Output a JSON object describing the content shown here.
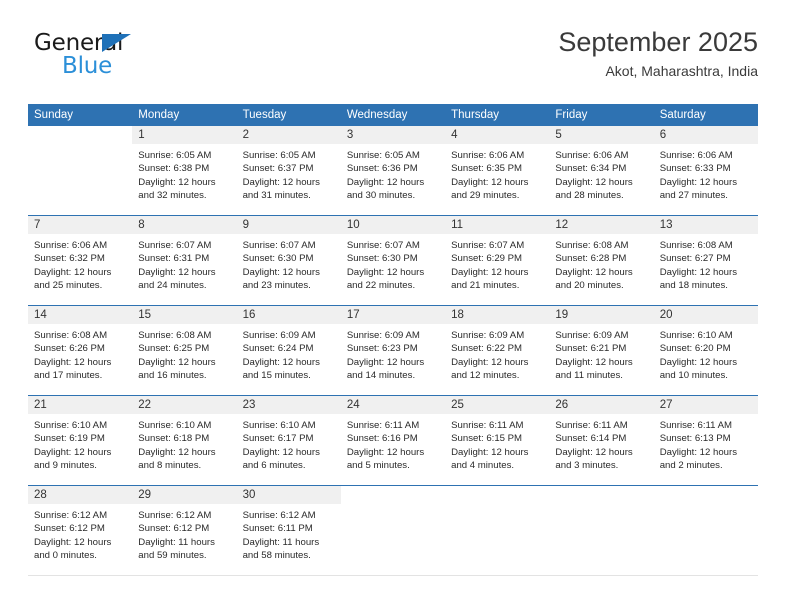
{
  "brand": {
    "name_top": "General",
    "name_bottom": "Blue",
    "triangle_icon": "brand-triangle-icon",
    "accent_color": "#1f71b8",
    "blue_text_color": "#2b8fd8"
  },
  "header": {
    "month_title": "September 2025",
    "location": "Akot, Maharashtra, India"
  },
  "theme": {
    "header_blue": "#2e72b2",
    "daynum_band": "#f0f0f0",
    "row_divider": "#2e72b2",
    "text": "#2a2a2a"
  },
  "calendar": {
    "weekday_headers": [
      "Sunday",
      "Monday",
      "Tuesday",
      "Wednesday",
      "Thursday",
      "Friday",
      "Saturday"
    ],
    "weeks": [
      [
        {
          "day": "",
          "sunrise": "",
          "sunset": "",
          "daylight_line1": "",
          "daylight_line2": "",
          "empty": true
        },
        {
          "day": "1",
          "sunrise": "Sunrise: 6:05 AM",
          "sunset": "Sunset: 6:38 PM",
          "daylight_line1": "Daylight: 12 hours",
          "daylight_line2": "and 32 minutes."
        },
        {
          "day": "2",
          "sunrise": "Sunrise: 6:05 AM",
          "sunset": "Sunset: 6:37 PM",
          "daylight_line1": "Daylight: 12 hours",
          "daylight_line2": "and 31 minutes."
        },
        {
          "day": "3",
          "sunrise": "Sunrise: 6:05 AM",
          "sunset": "Sunset: 6:36 PM",
          "daylight_line1": "Daylight: 12 hours",
          "daylight_line2": "and 30 minutes."
        },
        {
          "day": "4",
          "sunrise": "Sunrise: 6:06 AM",
          "sunset": "Sunset: 6:35 PM",
          "daylight_line1": "Daylight: 12 hours",
          "daylight_line2": "and 29 minutes."
        },
        {
          "day": "5",
          "sunrise": "Sunrise: 6:06 AM",
          "sunset": "Sunset: 6:34 PM",
          "daylight_line1": "Daylight: 12 hours",
          "daylight_line2": "and 28 minutes."
        },
        {
          "day": "6",
          "sunrise": "Sunrise: 6:06 AM",
          "sunset": "Sunset: 6:33 PM",
          "daylight_line1": "Daylight: 12 hours",
          "daylight_line2": "and 27 minutes."
        }
      ],
      [
        {
          "day": "7",
          "sunrise": "Sunrise: 6:06 AM",
          "sunset": "Sunset: 6:32 PM",
          "daylight_line1": "Daylight: 12 hours",
          "daylight_line2": "and 25 minutes."
        },
        {
          "day": "8",
          "sunrise": "Sunrise: 6:07 AM",
          "sunset": "Sunset: 6:31 PM",
          "daylight_line1": "Daylight: 12 hours",
          "daylight_line2": "and 24 minutes."
        },
        {
          "day": "9",
          "sunrise": "Sunrise: 6:07 AM",
          "sunset": "Sunset: 6:30 PM",
          "daylight_line1": "Daylight: 12 hours",
          "daylight_line2": "and 23 minutes."
        },
        {
          "day": "10",
          "sunrise": "Sunrise: 6:07 AM",
          "sunset": "Sunset: 6:30 PM",
          "daylight_line1": "Daylight: 12 hours",
          "daylight_line2": "and 22 minutes."
        },
        {
          "day": "11",
          "sunrise": "Sunrise: 6:07 AM",
          "sunset": "Sunset: 6:29 PM",
          "daylight_line1": "Daylight: 12 hours",
          "daylight_line2": "and 21 minutes."
        },
        {
          "day": "12",
          "sunrise": "Sunrise: 6:08 AM",
          "sunset": "Sunset: 6:28 PM",
          "daylight_line1": "Daylight: 12 hours",
          "daylight_line2": "and 20 minutes."
        },
        {
          "day": "13",
          "sunrise": "Sunrise: 6:08 AM",
          "sunset": "Sunset: 6:27 PM",
          "daylight_line1": "Daylight: 12 hours",
          "daylight_line2": "and 18 minutes."
        }
      ],
      [
        {
          "day": "14",
          "sunrise": "Sunrise: 6:08 AM",
          "sunset": "Sunset: 6:26 PM",
          "daylight_line1": "Daylight: 12 hours",
          "daylight_line2": "and 17 minutes."
        },
        {
          "day": "15",
          "sunrise": "Sunrise: 6:08 AM",
          "sunset": "Sunset: 6:25 PM",
          "daylight_line1": "Daylight: 12 hours",
          "daylight_line2": "and 16 minutes."
        },
        {
          "day": "16",
          "sunrise": "Sunrise: 6:09 AM",
          "sunset": "Sunset: 6:24 PM",
          "daylight_line1": "Daylight: 12 hours",
          "daylight_line2": "and 15 minutes."
        },
        {
          "day": "17",
          "sunrise": "Sunrise: 6:09 AM",
          "sunset": "Sunset: 6:23 PM",
          "daylight_line1": "Daylight: 12 hours",
          "daylight_line2": "and 14 minutes."
        },
        {
          "day": "18",
          "sunrise": "Sunrise: 6:09 AM",
          "sunset": "Sunset: 6:22 PM",
          "daylight_line1": "Daylight: 12 hours",
          "daylight_line2": "and 12 minutes."
        },
        {
          "day": "19",
          "sunrise": "Sunrise: 6:09 AM",
          "sunset": "Sunset: 6:21 PM",
          "daylight_line1": "Daylight: 12 hours",
          "daylight_line2": "and 11 minutes."
        },
        {
          "day": "20",
          "sunrise": "Sunrise: 6:10 AM",
          "sunset": "Sunset: 6:20 PM",
          "daylight_line1": "Daylight: 12 hours",
          "daylight_line2": "and 10 minutes."
        }
      ],
      [
        {
          "day": "21",
          "sunrise": "Sunrise: 6:10 AM",
          "sunset": "Sunset: 6:19 PM",
          "daylight_line1": "Daylight: 12 hours",
          "daylight_line2": "and 9 minutes."
        },
        {
          "day": "22",
          "sunrise": "Sunrise: 6:10 AM",
          "sunset": "Sunset: 6:18 PM",
          "daylight_line1": "Daylight: 12 hours",
          "daylight_line2": "and 8 minutes."
        },
        {
          "day": "23",
          "sunrise": "Sunrise: 6:10 AM",
          "sunset": "Sunset: 6:17 PM",
          "daylight_line1": "Daylight: 12 hours",
          "daylight_line2": "and 6 minutes."
        },
        {
          "day": "24",
          "sunrise": "Sunrise: 6:11 AM",
          "sunset": "Sunset: 6:16 PM",
          "daylight_line1": "Daylight: 12 hours",
          "daylight_line2": "and 5 minutes."
        },
        {
          "day": "25",
          "sunrise": "Sunrise: 6:11 AM",
          "sunset": "Sunset: 6:15 PM",
          "daylight_line1": "Daylight: 12 hours",
          "daylight_line2": "and 4 minutes."
        },
        {
          "day": "26",
          "sunrise": "Sunrise: 6:11 AM",
          "sunset": "Sunset: 6:14 PM",
          "daylight_line1": "Daylight: 12 hours",
          "daylight_line2": "and 3 minutes."
        },
        {
          "day": "27",
          "sunrise": "Sunrise: 6:11 AM",
          "sunset": "Sunset: 6:13 PM",
          "daylight_line1": "Daylight: 12 hours",
          "daylight_line2": "and 2 minutes."
        }
      ],
      [
        {
          "day": "28",
          "sunrise": "Sunrise: 6:12 AM",
          "sunset": "Sunset: 6:12 PM",
          "daylight_line1": "Daylight: 12 hours",
          "daylight_line2": "and 0 minutes."
        },
        {
          "day": "29",
          "sunrise": "Sunrise: 6:12 AM",
          "sunset": "Sunset: 6:12 PM",
          "daylight_line1": "Daylight: 11 hours",
          "daylight_line2": "and 59 minutes."
        },
        {
          "day": "30",
          "sunrise": "Sunrise: 6:12 AM",
          "sunset": "Sunset: 6:11 PM",
          "daylight_line1": "Daylight: 11 hours",
          "daylight_line2": "and 58 minutes."
        },
        {
          "day": "",
          "sunrise": "",
          "sunset": "",
          "daylight_line1": "",
          "daylight_line2": "",
          "empty": true
        },
        {
          "day": "",
          "sunrise": "",
          "sunset": "",
          "daylight_line1": "",
          "daylight_line2": "",
          "empty": true
        },
        {
          "day": "",
          "sunrise": "",
          "sunset": "",
          "daylight_line1": "",
          "daylight_line2": "",
          "empty": true
        },
        {
          "day": "",
          "sunrise": "",
          "sunset": "",
          "daylight_line1": "",
          "daylight_line2": "",
          "empty": true
        }
      ]
    ]
  }
}
